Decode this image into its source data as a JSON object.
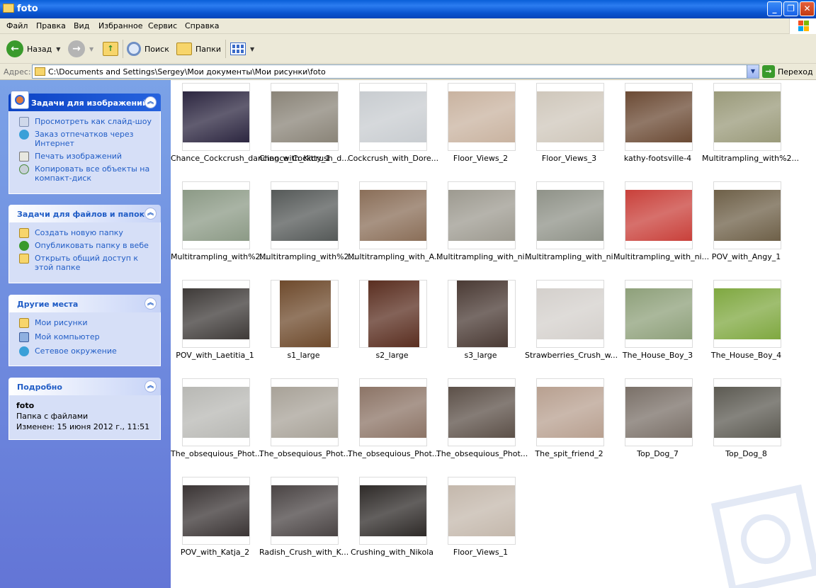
{
  "window": {
    "title": "foto"
  },
  "menu": [
    "Файл",
    "Правка",
    "Вид",
    "Избранное",
    "Сервис",
    "Справка"
  ],
  "toolbar": {
    "back": "Назад",
    "search": "Поиск",
    "folders": "Папки"
  },
  "address": {
    "label": "Адрес:",
    "path": "C:\\Documents and Settings\\Sergey\\Мои документы\\Мои рисунки\\foto",
    "go": "Переход"
  },
  "image_tasks": {
    "title": "Задачи для изображений",
    "items": [
      "Просмотреть как слайд-шоу",
      "Заказ отпечатков через Интернет",
      "Печать изображений",
      "Копировать все объекты на компакт-диск"
    ]
  },
  "file_tasks": {
    "title": "Задачи для файлов и папок",
    "items": [
      "Создать новую папку",
      "Опубликовать папку в вебе",
      "Открыть общий доступ к этой папке"
    ]
  },
  "other_places": {
    "title": "Другие места",
    "items": [
      "Мои рисунки",
      "Мой компьютер",
      "Сетевое окружение"
    ]
  },
  "details": {
    "title": "Подробно",
    "name": "foto",
    "type": "Папка с файлами",
    "modified": "Изменен: 15 июня 2012 г., 11:51"
  },
  "files": [
    {
      "name": "Chance_Cockcrush_dancing_with_Kitty_1",
      "color": "#2c2640"
    },
    {
      "name": "Chance_Cockcrush_d...",
      "color": "#8a8478"
    },
    {
      "name": "Cockcrush_with_Dore...",
      "color": "#c8ccd0"
    },
    {
      "name": "Floor_Views_2",
      "color": "#c9b3a0"
    },
    {
      "name": "Floor_Views_3",
      "color": "#cfc7bb"
    },
    {
      "name": "kathy-footsville-4",
      "color": "#6b4a34"
    },
    {
      "name": "Multitrampling_with%2...",
      "color": "#9a9a7a"
    },
    {
      "name": "Multitrampling_with%2...",
      "color": "#8c9a86"
    },
    {
      "name": "Multitrampling_with%2...",
      "color": "#555958"
    },
    {
      "name": "Multitrampling_with_A...",
      "color": "#8a6e58"
    },
    {
      "name": "Multitrampling_with_ni...",
      "color": "#9d9a90"
    },
    {
      "name": "Multitrampling_with_ni...",
      "color": "#8f9288"
    },
    {
      "name": "Multitrampling_with_ni...",
      "color": "#c9403a"
    },
    {
      "name": "POV_with_Angy_1",
      "color": "#6e6048"
    },
    {
      "name": "POV_with_Laetitia_1",
      "color": "#3e3a38"
    },
    {
      "name": "s1_large",
      "color": "#6e4a2c"
    },
    {
      "name": "s2_large",
      "color": "#5a2e20"
    },
    {
      "name": "s3_large",
      "color": "#4a3a34"
    },
    {
      "name": "Strawberries_Crush_w...",
      "color": "#d4d0cc"
    },
    {
      "name": "The_House_Boy_3",
      "color": "#8ea07a"
    },
    {
      "name": "The_House_Boy_4",
      "color": "#7fa840"
    },
    {
      "name": "The_obsequious_Phot...",
      "color": "#b8b8b4"
    },
    {
      "name": "The_obsequious_Phot...",
      "color": "#a8a298"
    },
    {
      "name": "The_obsequious_Phot...",
      "color": "#8c7466"
    },
    {
      "name": "The_obsequious_Phot...",
      "color": "#5c5048"
    },
    {
      "name": "The_spit_friend_2",
      "color": "#b8a090"
    },
    {
      "name": "Top_Dog_7",
      "color": "#7a7068"
    },
    {
      "name": "Top_Dog_8",
      "color": "#5c5a52"
    },
    {
      "name": "POV_with_Katja_2",
      "color": "#3a3434"
    },
    {
      "name": "Radish_Crush_with_K...",
      "color": "#4a4444"
    },
    {
      "name": "Crushing_with_Nikola",
      "color": "#2e2a28"
    },
    {
      "name": "Floor_Views_1",
      "color": "#c4b8ac"
    }
  ]
}
